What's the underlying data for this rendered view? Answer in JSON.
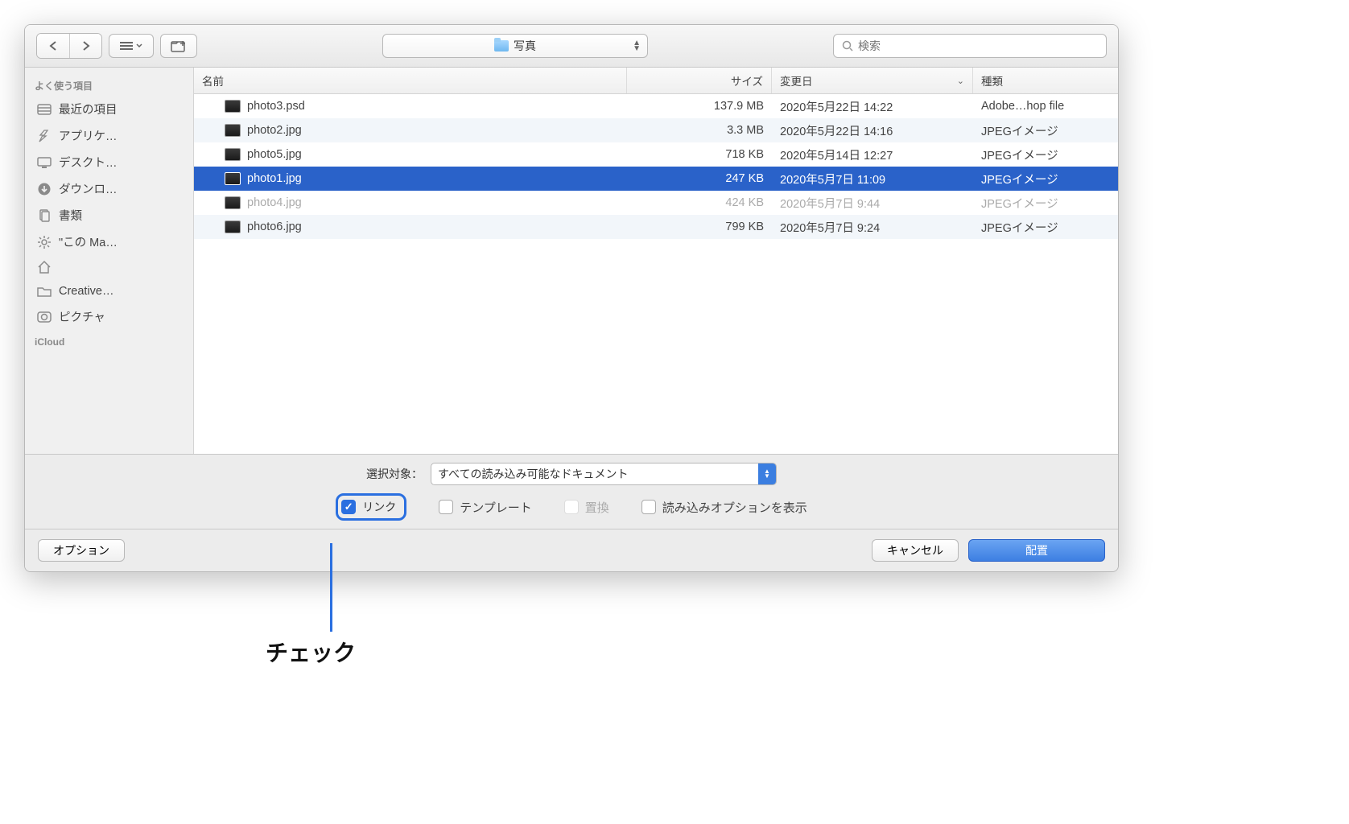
{
  "toolbar": {
    "folder_name": "写真",
    "search_placeholder": "検索"
  },
  "sidebar": {
    "section_favorites": "よく使う項目",
    "items": [
      {
        "label": "最近の項目",
        "icon": "recents"
      },
      {
        "label": "アプリケ…",
        "icon": "apps"
      },
      {
        "label": "デスクト…",
        "icon": "desktop"
      },
      {
        "label": "ダウンロ…",
        "icon": "downloads"
      },
      {
        "label": "書類",
        "icon": "documents"
      },
      {
        "label": "\"この Ma…",
        "icon": "gear"
      },
      {
        "label": "",
        "icon": "home"
      },
      {
        "label": "Creative…",
        "icon": "folder"
      },
      {
        "label": "ピクチャ",
        "icon": "pictures"
      }
    ],
    "section_icloud": "iCloud"
  },
  "columns": {
    "name": "名前",
    "size": "サイズ",
    "date": "変更日",
    "kind": "種類"
  },
  "files": [
    {
      "name": "photo3.psd",
      "size": "137.9 MB",
      "date": "2020年5月22日 14:22",
      "kind": "Adobe…hop file",
      "selected": false,
      "dimmed": false
    },
    {
      "name": "photo2.jpg",
      "size": "3.3 MB",
      "date": "2020年5月22日 14:16",
      "kind": "JPEGイメージ",
      "selected": false,
      "dimmed": false
    },
    {
      "name": "photo5.jpg",
      "size": "718 KB",
      "date": "2020年5月14日 12:27",
      "kind": "JPEGイメージ",
      "selected": false,
      "dimmed": false
    },
    {
      "name": "photo1.jpg",
      "size": "247 KB",
      "date": "2020年5月7日 11:09",
      "kind": "JPEGイメージ",
      "selected": true,
      "dimmed": false
    },
    {
      "name": "photo4.jpg",
      "size": "424 KB",
      "date": "2020年5月7日 9:44",
      "kind": "JPEGイメージ",
      "selected": false,
      "dimmed": true
    },
    {
      "name": "photo6.jpg",
      "size": "799 KB",
      "date": "2020年5月7日 9:24",
      "kind": "JPEGイメージ",
      "selected": false,
      "dimmed": false
    }
  ],
  "options": {
    "enable_label": "選択対象：",
    "enable_value": "すべての読み込み可能なドキュメント",
    "link": "リンク",
    "template": "テンプレート",
    "replace": "置換",
    "show_import": "読み込みオプションを表示"
  },
  "buttons": {
    "options": "オプション",
    "cancel": "キャンセル",
    "place": "配置"
  },
  "callout": "チェック"
}
